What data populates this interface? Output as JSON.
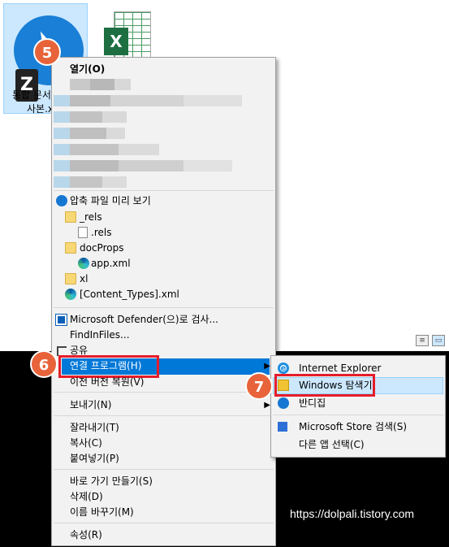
{
  "desktop": {
    "selected_file_label_line1": "통합 문서",
    "selected_file_label_line2": "사본.xlsx",
    "selected_file_icon_letter": "Z",
    "excel_icon_letter": "X"
  },
  "badges": {
    "step5": "5",
    "step6": "6",
    "step7": "7"
  },
  "main_menu": {
    "open": "열기(O)",
    "zip_preview": "압축 파일 미리 보기",
    "tree": [
      {
        "label": "_rels",
        "icon": "folder-icon"
      },
      {
        "label": ".rels",
        "icon": "file-icon"
      },
      {
        "label": "docProps",
        "icon": "folder-icon"
      },
      {
        "label": "app.xml",
        "icon": "edge-icon"
      },
      {
        "label": "xl",
        "icon": "folder-icon"
      },
      {
        "label": "[Content_Types].xml",
        "icon": "edge-icon"
      }
    ],
    "defender": "Microsoft Defender(으)로 검사...",
    "findinfiles": "FindInFiles...",
    "share": "공유",
    "open_with": "연결 프로그램(H)",
    "restore_prev": "이전 버전 복원(V)",
    "send_to": "보내기(N)",
    "cut": "잘라내기(T)",
    "copy": "복사(C)",
    "paste": "붙여넣기(P)",
    "create_shortcut": "바로 가기 만들기(S)",
    "delete": "삭제(D)",
    "rename": "이름 바꾸기(M)",
    "properties": "속성(R)"
  },
  "sub_menu": {
    "ie": "Internet Explorer",
    "explorer": "Windows 탐색기",
    "bandizip": "반디집",
    "store_search": "Microsoft Store 검색(S)",
    "choose_other": "다른 앱 선택(C)"
  },
  "watermark": "https://dolpali.tistory.com",
  "colors": {
    "accent": "#0078d7",
    "highlight": "#cce8ff",
    "badge": "#e8633a",
    "red_box": "#e51d2a"
  }
}
